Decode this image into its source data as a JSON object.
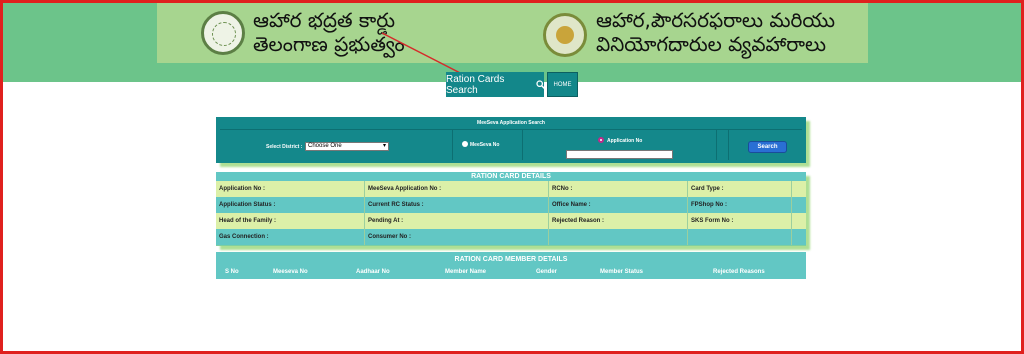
{
  "banner": {
    "left_line1": "ఆహార భద్రత కార్డు",
    "left_line2": "తెలంగాణ ప్రభుత్వం",
    "right_line1": "ఆహార,పౌరసరఫరాలు మరియు",
    "right_line2": "వినియోగదారుల వ్యవహారాలు"
  },
  "nav": {
    "ration_search_label": "Ration Cards Search",
    "home_label": "HOME"
  },
  "search_form": {
    "title": "MeeSeva Application Search",
    "district_label": "Select District :",
    "district_selected": "Choose One",
    "radio_meeseva_label": "MeeSeva No",
    "radio_application_label": "Application No",
    "application_input_value": "",
    "search_button": "Search"
  },
  "details": {
    "title": "RATION CARD DETAILS",
    "rows": [
      [
        "Application No :",
        "MeeSeva Application No :",
        "RCNo :",
        "Card Type :"
      ],
      [
        "Application Status :",
        "Current RC Status :",
        "Office Name :",
        "FPShop No :"
      ],
      [
        "Head of the Family :",
        "Pending At :",
        "Rejected Reason :",
        "SKS Form No :"
      ],
      [
        "Gas Connection :",
        "Consumer No :",
        "",
        ""
      ]
    ]
  },
  "members": {
    "title": "RATION CARD MEMBER DETAILS",
    "columns": [
      "S No",
      "Meeseva No",
      "Aadhaar No",
      "Member Name",
      "Gender",
      "Member Status",
      "Rejected Reasons"
    ]
  },
  "colors": {
    "frame": "#e0201e",
    "header_band": "#6cc48a",
    "banner": "#a7d58f",
    "teal": "#14888b",
    "row_light": "#dcf0a8",
    "row_teal": "#62c7c4",
    "search_button": "#2a6fd4",
    "arrow": "#d62a2a"
  },
  "icons": [
    "search-icon",
    "telangana-emblem-icon",
    "civil-supplies-emblem-icon"
  ]
}
